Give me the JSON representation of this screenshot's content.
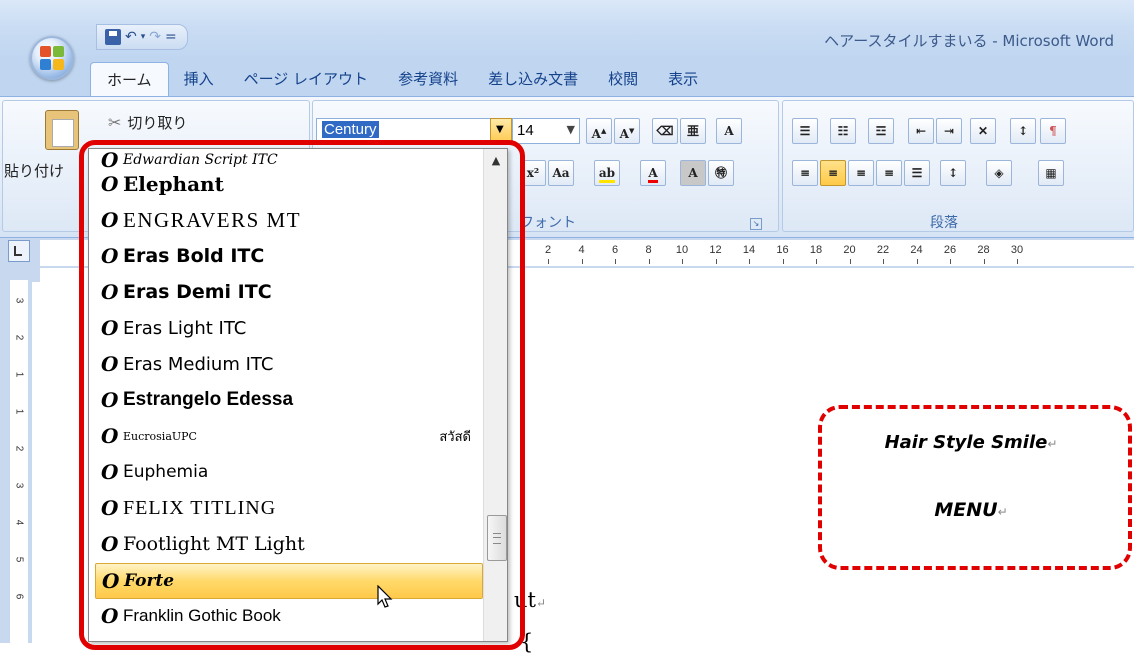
{
  "window": {
    "title": "ヘアースタイルすまいる - Microsoft Word"
  },
  "quick_access": {
    "customize_label": "="
  },
  "tabs": [
    {
      "label": "ホーム",
      "active": true
    },
    {
      "label": "挿入"
    },
    {
      "label": "ページ レイアウト"
    },
    {
      "label": "参考資料"
    },
    {
      "label": "差し込み文書"
    },
    {
      "label": "校閲"
    },
    {
      "label": "表示"
    }
  ],
  "ribbon": {
    "clipboard": {
      "paste_label": "貼り付け",
      "cut_label": "切り取り"
    },
    "font": {
      "current_font": "Century",
      "current_size": "14",
      "group_label": "フォント"
    },
    "paragraph": {
      "group_label": "段落"
    }
  },
  "ruler": {
    "ticks": [
      "2",
      "4",
      "6",
      "8",
      "10",
      "12",
      "14",
      "16",
      "18",
      "20",
      "22",
      "24",
      "26",
      "28",
      "30"
    ],
    "vticks": [
      "3",
      "2",
      "1",
      "1",
      "2",
      "3",
      "4",
      "5",
      "6"
    ]
  },
  "font_list": {
    "items": [
      {
        "name": "Edwardian Script ITC",
        "icon": "O",
        "style": "script"
      },
      {
        "name": "Elephant",
        "icon": "O",
        "style": "elephant"
      },
      {
        "name": "ENGRAVERS MT",
        "icon": "O",
        "style": "engravers"
      },
      {
        "name": "Eras Bold ITC",
        "icon": "O",
        "style": "eras-bold"
      },
      {
        "name": "Eras Demi ITC",
        "icon": "O",
        "style": "eras-demi"
      },
      {
        "name": "Eras Light ITC",
        "icon": "O",
        "style": "eras-light"
      },
      {
        "name": "Eras Medium ITC",
        "icon": "O",
        "style": "eras-medium"
      },
      {
        "name": "Estrangelo Edessa",
        "icon": "O",
        "style": "estrangelo"
      },
      {
        "name": "EucrosiaUPC",
        "icon": "O",
        "style": "eucrosia",
        "sample": "สวัสดี"
      },
      {
        "name": "Euphemia",
        "icon": "O",
        "style": "euphemia"
      },
      {
        "name": "FELIX TITLING",
        "icon": "O",
        "style": "felix"
      },
      {
        "name": "Footlight MT Light",
        "icon": "O",
        "style": "footlight"
      },
      {
        "name": "Forte",
        "icon": "O",
        "style": "forte",
        "selected": true
      },
      {
        "name": "Franklin Gothic Book",
        "icon": "O",
        "style": "franklin"
      }
    ]
  },
  "document": {
    "frame_title": "Hair Style Smile",
    "frame_menu": "MENU",
    "text_fragment_1": "ut",
    "text_fragment_2": "{"
  },
  "colors": {
    "highlight_ring": "#e00000",
    "selected_item": "#ffd96a",
    "ribbon_blue": "#bfd5f0"
  }
}
